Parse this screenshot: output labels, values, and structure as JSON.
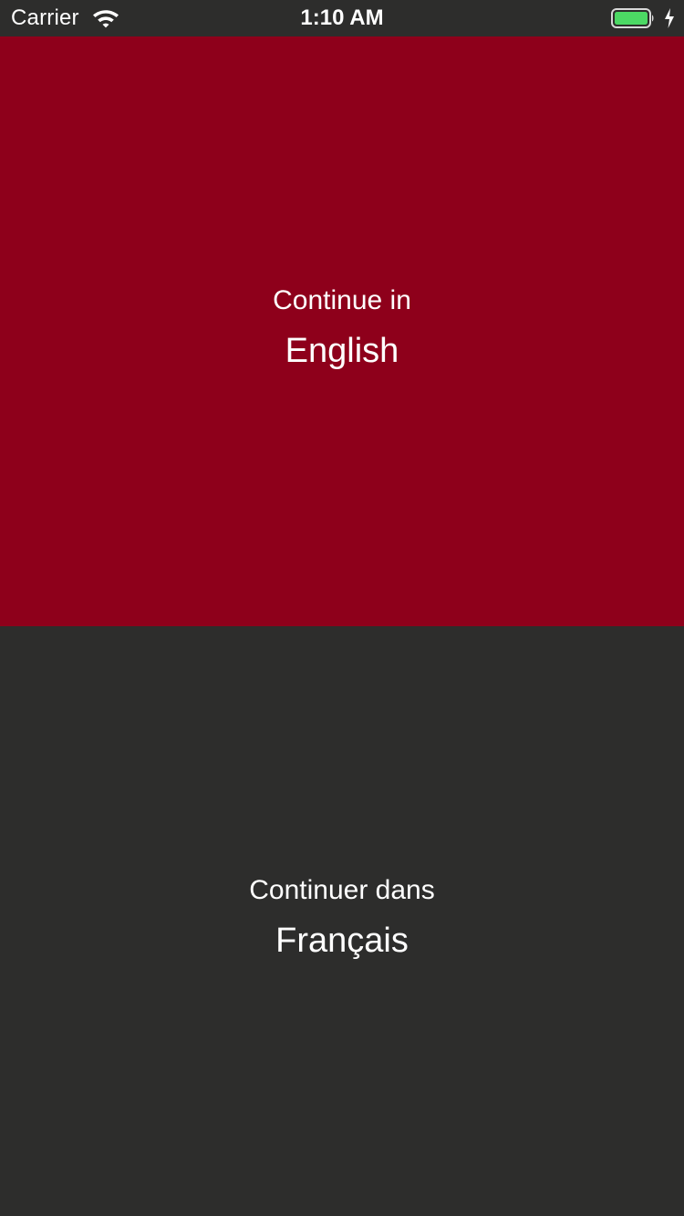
{
  "status_bar": {
    "carrier": "Carrier",
    "time": "1:10 AM",
    "wifi_icon": "wifi-icon",
    "battery_icon": "battery-icon",
    "charging_icon": "charging-bolt-icon",
    "battery_color": "#4cd964"
  },
  "languages": {
    "english": {
      "prompt": "Continue in",
      "language": "English",
      "background": "#8e001b"
    },
    "french": {
      "prompt": "Continuer dans",
      "language": "Français",
      "background": "#2d2d2c"
    }
  }
}
